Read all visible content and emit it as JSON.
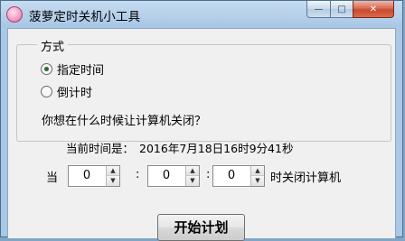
{
  "window": {
    "title": "菠萝定时关机小工具",
    "controls": {
      "minimize": "—",
      "maximize": "□",
      "close": "✕"
    }
  },
  "mode_group": {
    "legend": "方式",
    "options": [
      {
        "label": "指定时间",
        "selected": true
      },
      {
        "label": "倒计时",
        "selected": false
      }
    ]
  },
  "question": "你想在什么时候让计算机关闭？",
  "current_time": {
    "label": "当前时间是：",
    "value": "2016年7月18日16时9分41秒"
  },
  "schedule": {
    "prefix": "当",
    "fields": [
      "0",
      "0",
      "0"
    ],
    "separators": [
      ":",
      ":"
    ],
    "suffix": "时关闭计算机"
  },
  "start_button": "开始计划",
  "icons": {
    "app": "app-icon",
    "spin_up": "▲",
    "spin_down": "▼"
  }
}
